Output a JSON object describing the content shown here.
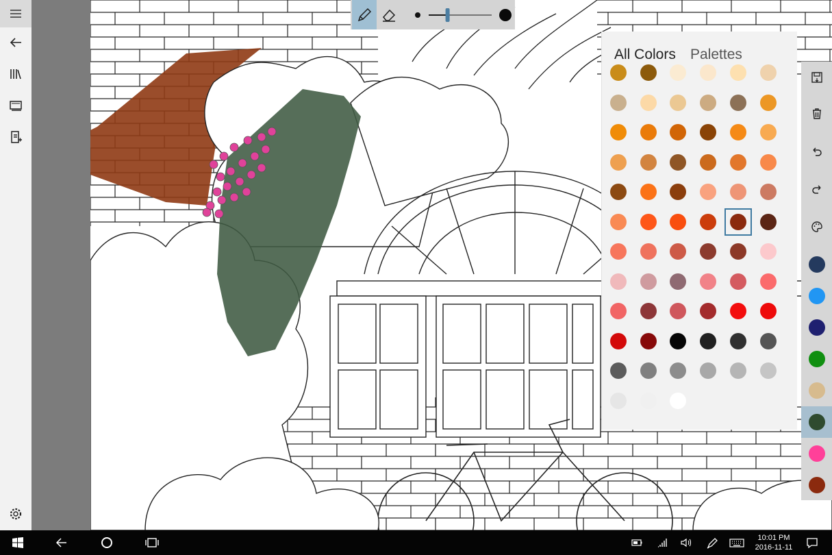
{
  "nav": {
    "icons": [
      "hamburger-icon",
      "back-arrow-icon",
      "library-icon",
      "gallery-icon",
      "new-page-icon",
      "settings-icon"
    ]
  },
  "toolbar": {
    "tools": [
      "pencil-icon",
      "eraser-icon"
    ],
    "brush_size_fraction": 0.3
  },
  "color_panel": {
    "tab_all_colors": "All Colors",
    "tab_palettes": "Palettes",
    "selected_color": "#8b2a0e",
    "rows": [
      [
        "#c98c1a",
        "#8c5a0b",
        "#fbebd2",
        "#fbe7cc",
        "#fde0b0",
        "#efd2ad"
      ],
      [
        "#c9b08e",
        "#fcd9a7",
        "#ebc893",
        "#ccab82",
        "#8c7157",
        "#ec9725"
      ],
      [
        "#f08c08",
        "#ea7b0a",
        "#d16506",
        "#8a4306",
        "#f58a16",
        "#f8aa51"
      ],
      [
        "#eea050",
        "#d28440",
        "#8f5626",
        "#cb6a1d",
        "#e2772c",
        "#f8894a"
      ],
      [
        "#8c4a12",
        "#fb7217",
        "#8b3e0d",
        "#f9a27f",
        "#ee9576",
        "#cc7a62"
      ],
      [
        "#f98a54",
        "#fe5719",
        "#f94e0f",
        "#cb3d0c",
        "#8b2a0e",
        "#5b2515"
      ],
      [
        "#f7765c",
        "#ef725d",
        "#cd5a47",
        "#8c3b2e",
        "#8c3827",
        "#fcc9cc"
      ],
      [
        "#f0b9bb",
        "#cf9b9f",
        "#8f6a72",
        "#f18288",
        "#d45b60",
        "#fb6b6c"
      ],
      [
        "#f16565",
        "#8d3638",
        "#cf575c",
        "#a32b2c",
        "#f30d0d",
        "#ee0a0a"
      ],
      [
        "#d30a0a",
        "#870909",
        "#050505",
        "#202020",
        "#303030",
        "#555555"
      ],
      [
        "#5c5c5c",
        "#808080",
        "#8c8c8c",
        "#a8a8a8",
        "#b5b5b5",
        "#c5c5c5"
      ],
      [
        "#e6e6e6",
        "#f0f0f0",
        "#ffffff"
      ]
    ]
  },
  "rail": {
    "actions": [
      "save-icon",
      "delete-icon",
      "undo-icon",
      "redo-icon",
      "palette-icon"
    ],
    "recent_colors": [
      "#243a5e",
      "#2196f3",
      "#1f2070",
      "#108f10",
      "#d7bb8e",
      "#2f4b2f",
      "#ff4099",
      "#8b2a0e"
    ],
    "active_color": "#2f4b2f"
  },
  "taskbar": {
    "icons": [
      "windows-start-icon",
      "back-icon",
      "cortana-icon",
      "task-view-icon",
      "battery-icon",
      "wifi-icon",
      "volume-icon",
      "pen-icon",
      "keyboard-icon",
      "notifications-icon"
    ],
    "time": "10:01 PM",
    "date": "2016-11-11"
  }
}
